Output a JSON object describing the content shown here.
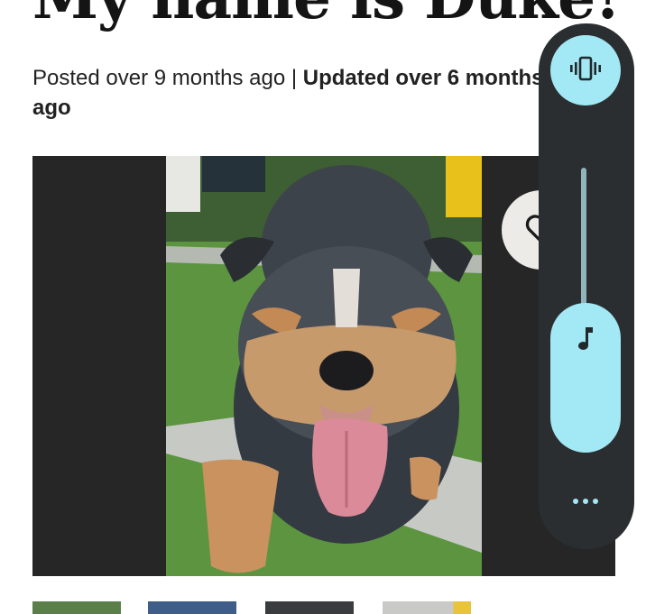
{
  "article": {
    "title": "My name is Duke!",
    "posted": "Posted over 9 months ago | ",
    "updated": "Updated over 6 months ago"
  },
  "gallery": {
    "thumbnail_count": 4
  },
  "volume_panel": {
    "ringer_mode_icon": "vibrate-icon",
    "media_icon": "music-note-icon",
    "more_icon": "more-horizontal-icon",
    "media_volume_level": 0.65,
    "accent_color": "#a3e8f5",
    "panel_color": "#2b2e30"
  }
}
